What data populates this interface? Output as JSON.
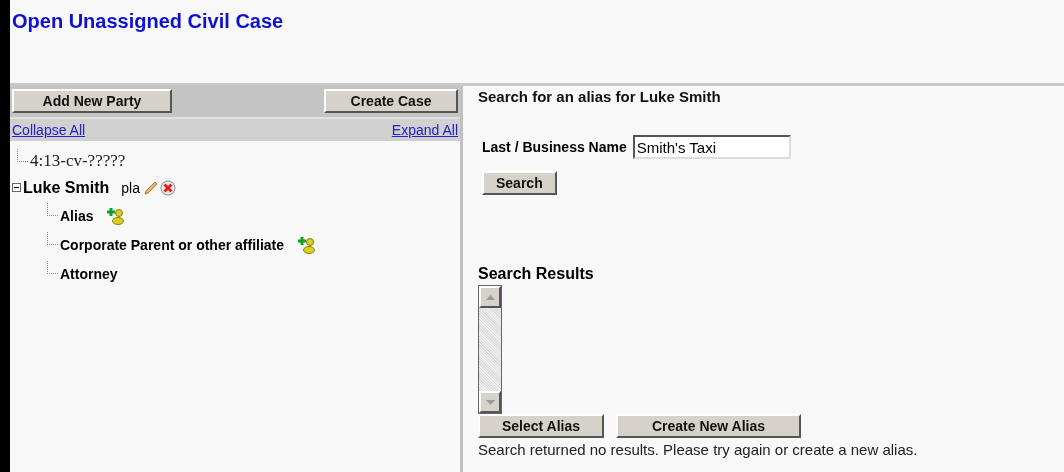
{
  "title": "Open Unassigned Civil Case",
  "left": {
    "add_button": "Add New Party",
    "create_button": "Create Case",
    "collapse_link": "Collapse All",
    "expand_link": "Expand All",
    "tree": [
      {
        "kind": "case",
        "label": "4:13-cv-?????"
      },
      {
        "kind": "party",
        "label": "Luke Smith",
        "role": "pla",
        "expanded": true,
        "children": [
          {
            "kind": "addable",
            "label": "Alias"
          },
          {
            "kind": "addable",
            "label": "Corporate Parent or other affiliate"
          },
          {
            "kind": "plain",
            "label": "Attorney"
          }
        ]
      }
    ]
  },
  "right": {
    "heading": "Search for an alias for Luke Smith",
    "field_label": "Last / Business Name",
    "field_value": "Smith's Taxi",
    "search_button": "Search",
    "results_heading": "Search Results",
    "select_button": "Select Alias",
    "create_alias_button": "Create New Alias",
    "message": "Search returned no results. Please try again or create a new alias."
  }
}
